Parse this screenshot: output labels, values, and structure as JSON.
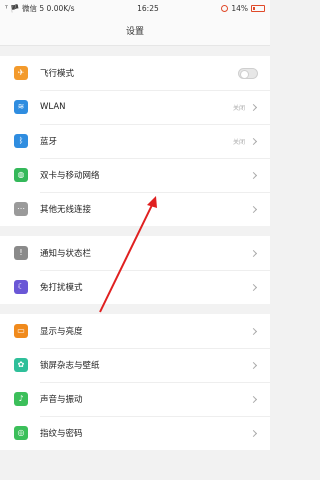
{
  "status": {
    "left": "ᵀ 🏴 微信 5 0.00K/s",
    "time": "16:25",
    "battery_pct": "14%"
  },
  "header": {
    "title": "设置"
  },
  "groups": [
    {
      "items": [
        {
          "label": "飞行模式",
          "icon": "airplane-icon",
          "color": "#f39a2c",
          "control": "toggle"
        },
        {
          "label": "WLAN",
          "value": "关闭",
          "icon": "wifi-icon",
          "color": "#2f8de0",
          "control": "chevron"
        },
        {
          "label": "蓝牙",
          "value": "关闭",
          "icon": "bluetooth-icon",
          "color": "#2f8de0",
          "control": "chevron"
        },
        {
          "label": "双卡与移动网络",
          "icon": "globe-icon",
          "color": "#34b85a",
          "control": "chevron"
        },
        {
          "label": "其他无线连接",
          "icon": "more-icon",
          "color": "#9a9a9a",
          "control": "chevron"
        }
      ]
    },
    {
      "items": [
        {
          "label": "通知与状态栏",
          "icon": "notification-icon",
          "color": "#8a8a8a",
          "control": "chevron"
        },
        {
          "label": "免打扰模式",
          "icon": "moon-icon",
          "color": "#6a57d6",
          "control": "chevron"
        }
      ]
    },
    {
      "items": [
        {
          "label": "显示与亮度",
          "icon": "display-icon",
          "color": "#f08a1c",
          "control": "chevron"
        },
        {
          "label": "锁屏杂志与壁纸",
          "icon": "wallpaper-icon",
          "color": "#2fbf9a",
          "control": "chevron"
        },
        {
          "label": "声音与振动",
          "icon": "sound-icon",
          "color": "#3cbf5a",
          "control": "chevron"
        },
        {
          "label": "指纹与密码",
          "icon": "fingerprint-icon",
          "color": "#3cbf5a",
          "control": "chevron"
        }
      ]
    }
  ],
  "annotation": {
    "color": "#e02020"
  }
}
